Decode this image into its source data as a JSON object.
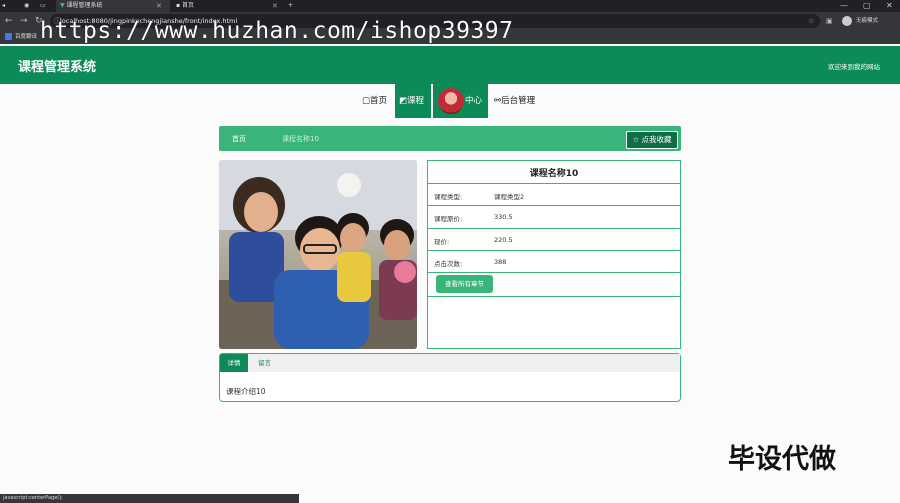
{
  "browser": {
    "tabs": [
      {
        "label": "课程管理系统",
        "active": true
      },
      {
        "label": "首页",
        "active": false
      }
    ],
    "url": "localhost:8080/jingpinkechengjianshe/front/index.html",
    "bookmarks": [
      "百度翻译"
    ],
    "profile_label": "无痕模式",
    "window_controls": [
      "—",
      "▢",
      "✕"
    ]
  },
  "watermark": "https://www.huzhan.com/ishop39397",
  "header": {
    "title": "课程管理系统",
    "welcome": "欢迎来到我的网站",
    "brand_color": "#0c8a58"
  },
  "nav": {
    "items": [
      {
        "label": "首页",
        "icon": "home-icon",
        "active": false
      },
      {
        "label": "课程",
        "icon": "book-icon",
        "active": true
      },
      {
        "label": "中心",
        "icon": "avatar",
        "active": false
      },
      {
        "label": "后台管理",
        "icon": "link-icon",
        "active": false
      }
    ]
  },
  "breadcrumb": {
    "home": "首页",
    "current": "课程名称10"
  },
  "favorite_button": "☆ 点我收藏",
  "course": {
    "name": "课程名称10",
    "fields": [
      {
        "label": "课程类型:",
        "value": "课程类型2"
      },
      {
        "label": "课程原价:",
        "value": "330.5"
      },
      {
        "label": "现价:",
        "value": "220.5"
      },
      {
        "label": "点击次数:",
        "value": "388"
      }
    ],
    "chapters_button": "查看所有章节"
  },
  "tabs": {
    "items": [
      "详情",
      "留言"
    ],
    "active_index": 0,
    "content": "课程介绍10"
  },
  "corner_text": "毕设代做",
  "status": "javascript:centerPage();"
}
